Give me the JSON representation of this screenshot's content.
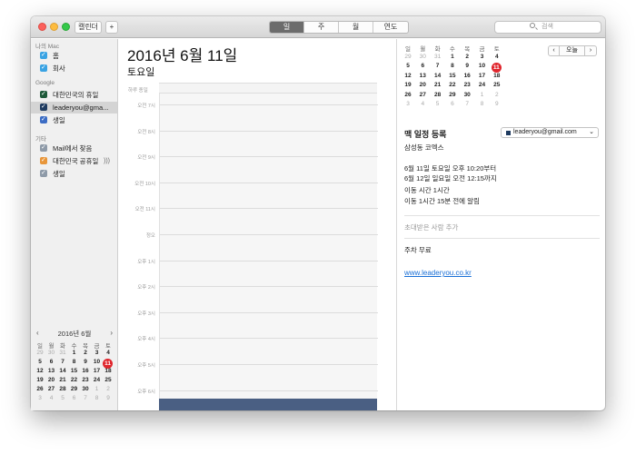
{
  "toolbar": {
    "calendars_label": "캘린더",
    "add_label": "+",
    "views": [
      "일",
      "주",
      "월",
      "연도"
    ],
    "active_view": "일",
    "search_placeholder": "검색"
  },
  "sidebar": {
    "groups": [
      {
        "title": "나의 Mac",
        "items": [
          {
            "label": "홈",
            "color": "#3aa3e3"
          },
          {
            "label": "회사",
            "color": "#3aa3e3"
          }
        ]
      },
      {
        "title": "Google",
        "items": [
          {
            "label": "대한민국의 휴일",
            "color": "#1e5a3a"
          },
          {
            "label": "leaderyou@gma...",
            "color": "#1e3a5f",
            "selected": true
          },
          {
            "label": "생일",
            "color": "#3b6cc4"
          }
        ]
      },
      {
        "title": "기타",
        "items": [
          {
            "label": "Mail에서 찾음",
            "color": "#8e9aa8"
          },
          {
            "label": "대한민국 공휴일",
            "color": "#e8963a",
            "icon": "broadcast-icon"
          },
          {
            "label": "생일",
            "color": "#8e9aa8"
          }
        ]
      }
    ],
    "mini_calendar": {
      "title": "2016년 6월",
      "weekdays": [
        "일",
        "월",
        "화",
        "수",
        "목",
        "금",
        "토"
      ],
      "weeks": [
        [
          "29",
          "30",
          "31",
          "1",
          "2",
          "3",
          "4"
        ],
        [
          "5",
          "6",
          "7",
          "8",
          "9",
          "10",
          "11"
        ],
        [
          "12",
          "13",
          "14",
          "15",
          "16",
          "17",
          "18"
        ],
        [
          "19",
          "20",
          "21",
          "22",
          "23",
          "24",
          "25"
        ],
        [
          "26",
          "27",
          "28",
          "29",
          "30",
          "1",
          "2"
        ],
        [
          "3",
          "4",
          "5",
          "6",
          "7",
          "8",
          "9"
        ]
      ],
      "today": "11"
    }
  },
  "main": {
    "date_title": "2016년 6월 11일",
    "weekday": "토요일",
    "all_day_label": "하루 종일",
    "hours": [
      "오전 7시",
      "오전 8시",
      "오전 9시",
      "오전 10시",
      "오전 11시",
      "정오",
      "오후 1시",
      "오후 2시",
      "오후 3시",
      "오후 4시",
      "오후 5시",
      "오후 6시"
    ]
  },
  "inspector": {
    "mini_calendar": {
      "weekdays": [
        "일",
        "월",
        "화",
        "수",
        "목",
        "금",
        "토"
      ],
      "weeks": [
        [
          "29",
          "30",
          "31",
          "1",
          "2",
          "3",
          "4"
        ],
        [
          "5",
          "6",
          "7",
          "8",
          "9",
          "10",
          "11"
        ],
        [
          "12",
          "13",
          "14",
          "15",
          "16",
          "17",
          "18"
        ],
        [
          "19",
          "20",
          "21",
          "22",
          "23",
          "24",
          "25"
        ],
        [
          "26",
          "27",
          "28",
          "29",
          "30",
          "1",
          "2"
        ],
        [
          "3",
          "4",
          "5",
          "6",
          "7",
          "8",
          "9"
        ]
      ],
      "today": "11",
      "today_label": "오늘"
    },
    "title": "맥 일정 등록",
    "location": "삼성동 코엑스",
    "calendar_select": "leaderyou@gmail.com",
    "time_line1": "6월 11일 토요일 오후 10:20부터",
    "time_line2": "6월 12일 일요일 오전 12:15까지",
    "travel_time": "이동 시간 1시간",
    "alert": "이동 1시간 15분 전에 알림",
    "invitees_placeholder": "초대받은 사람 추가",
    "note": "주차 무료",
    "url": "www.leaderyou.co.kr"
  }
}
